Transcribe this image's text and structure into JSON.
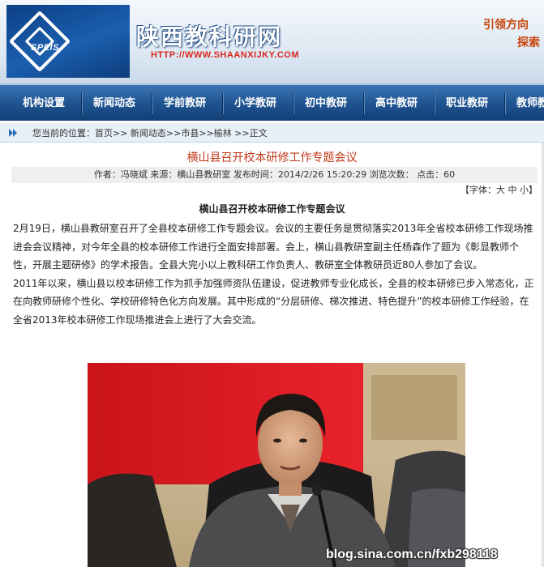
{
  "header": {
    "logo_text": "SPEIS",
    "site_title": "陕西教科研网",
    "site_url": "HTTP://WWW.SHAANXIJKY.COM",
    "slogan_line1": "引领方向",
    "slogan_line2": "探索"
  },
  "nav": {
    "items": [
      "机构设置",
      "新闻动态",
      "学前教研",
      "小学教研",
      "初中教研",
      "高中教研",
      "职业教研",
      "教师教"
    ]
  },
  "breadcrumb": {
    "text": "您当前的位置：首页>> 新闻动态>>市县>>榆林 >>正文"
  },
  "article": {
    "title": "横山县召开校本研修工作专题会议",
    "meta": "作者：冯晓斌  来源：横山县教研室  发布时间：2014/2/26 15:20:29  浏览次数：  点击：60",
    "font_size_label": "【字体：",
    "font_large": "大",
    "font_medium": "中",
    "font_small": "小",
    "font_size_end": "】",
    "subtitle": "横山县召开校本研修工作专题会议",
    "paragraph1": "2月19日，横山县教研室召开了全县校本研修工作专题会议。会议的主要任务是贯彻落实2013年全省校本研修工作现场推进会会议精神，对今年全县的校本研修工作进行全面安排部署。会上，横山县教研室副主任杨森作了题为《彰显教师个性，开展主题研修》的学术报告。全县大完小以上教科研工作负责人、教研室全体教研员近80人参加了会议。",
    "paragraph2": "2011年以来，横山县以校本研修工作为抓手加强师资队伍建设，促进教师专业化成长，全县的校本研修已步入常态化，正在向教师研修个性化、学校研修特色化方向发展。其中形成的“分层研修、梯次推进、特色提升”的校本研修工作经验，在全省2013年校本研修工作现场推进会上进行了大会交流。"
  },
  "photo": {
    "watermark": "blog.sina.com.cn/fxb298118"
  },
  "colors": {
    "nav_blue": "#205592",
    "title_red": "#c0391b",
    "url_red": "#d9261c",
    "slogan_orange": "#c8440a"
  }
}
